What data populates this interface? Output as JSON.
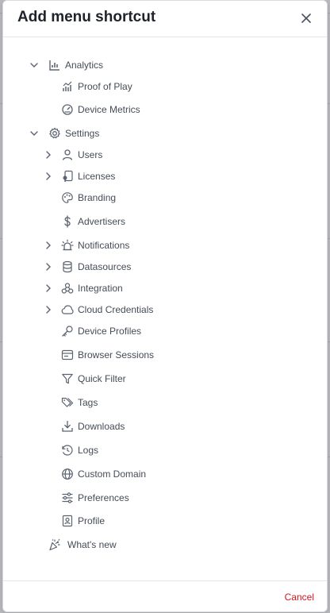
{
  "modal": {
    "title": "Add menu shortcut",
    "cancel_label": "Cancel"
  },
  "tree": {
    "analytics": {
      "label": "Analytics",
      "children": [
        "Proof of Play",
        "Device Metrics"
      ]
    },
    "settings": {
      "label": "Settings",
      "children": [
        "Users",
        "Licenses",
        "Branding",
        "Advertisers",
        "Notifications",
        "Datasources",
        "Integration",
        "Cloud Credentials",
        "Device Profiles",
        "Browser Sessions",
        "Quick Filter",
        "Tags",
        "Downloads",
        "Logs",
        "Custom Domain",
        "Preferences",
        "Profile"
      ]
    },
    "whats_new": {
      "label": "What's new"
    }
  },
  "icons": {
    "close": "x-icon",
    "analytics": "bar-chart-icon",
    "settings": "gear-icon",
    "whats_new": "party-popper-icon"
  },
  "colors": {
    "title": "#1f2329",
    "text": "#454c57",
    "icon": "#5b6370",
    "cancel": "#d8151f"
  }
}
